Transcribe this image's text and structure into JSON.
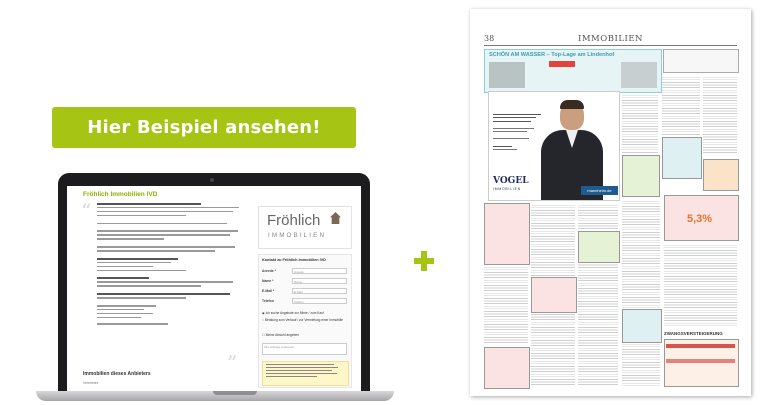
{
  "cta": {
    "label": "Hier Beispiel ansehen!"
  },
  "laptop_screen": {
    "page_title": "Fröhlich Immobilien IVD",
    "logo_line1": "Fröhlich",
    "logo_line2": "IMMOBILIEN",
    "contact_form": {
      "heading": "Kontakt zu Fröhlich Immobilien IVD",
      "fields": [
        {
          "label": "Anrede *",
          "value": "Anrede"
        },
        {
          "label": "Name *",
          "value": "Name"
        },
        {
          "label": "E-Mail *",
          "value": "E-Mail"
        },
        {
          "label": "Telefon",
          "value": "Telefon"
        }
      ],
      "radio_1": "Ich suche Angebote zur Miete / zum Kauf",
      "radio_2": "Beratung zum Verkauf / zur Vermietung einer Immobilie",
      "checkbox": "Meine Absicht angeben",
      "message_placeholder": "Ihre Anfrage (optional)"
    },
    "section_title": "Immobilien dieses Anbieters",
    "footer_small": "Vermietet"
  },
  "newspaper": {
    "page_number": "38",
    "section_heading": "IMMOBILIEN",
    "banner_title": "SCHÖN AM WASSER – Top-Lage am Lindenhof",
    "ad_brand": "VOGEL",
    "ad_brand_sub": "IMMOBILIEN",
    "ad_badge": "mannheim.de",
    "big_percent": "5,3%",
    "auction_heading": "ZWANGSVERSTEIGERUNG"
  },
  "colors": {
    "accent_green": "#a5c414",
    "newspaper_teal": "#3d9db3",
    "newspaper_red": "#d9534f"
  }
}
